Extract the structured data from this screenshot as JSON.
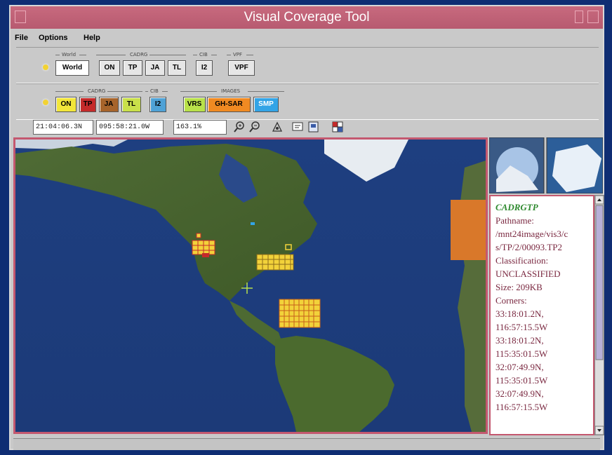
{
  "window": {
    "title": "Visual Coverage Tool"
  },
  "menu": {
    "file": "File",
    "options": "Options",
    "help": "Help"
  },
  "row1": {
    "groups": [
      "World",
      "CADRG",
      "CIB",
      "VPF"
    ],
    "buttons": [
      "World",
      "ON",
      "TP",
      "JA",
      "TL",
      "I2",
      "VPF"
    ]
  },
  "row2": {
    "groups": [
      "CADRG",
      "CIB",
      "IMAGES"
    ],
    "buttons": [
      "ON",
      "TP",
      "JA",
      "TL",
      "I2",
      "VRS",
      "GH-SAR",
      "SMP"
    ]
  },
  "coords": {
    "lat": "21:04:06.3N",
    "lon": "095:58:21.0W",
    "zoom": "163.1%"
  },
  "info": {
    "title": "CADRGTP",
    "lines": [
      "Pathname:",
      "/mnt24image/vis3/c",
      "s/TP/2/00093.TP2",
      "Classification:",
      "UNCLASSIFIED",
      "Size: 209KB",
      "Corners:",
      "  33:18:01.2N,",
      "116:57:15.5W",
      "  33:18:01.2N,",
      "115:35:01.5W",
      "  32:07:49.9N,",
      "115:35:01.5W",
      "  32:07:49.9N,",
      "116:57:15.5W"
    ]
  },
  "colors": {
    "title_bar": "#b75a70",
    "accent": "#c4586f",
    "on": "#f2e63a",
    "tp": "#c42a2a",
    "ja": "#a7642b",
    "tl": "#c9e04a",
    "i2": "#4fa2d6",
    "vrs": "#b9e14a",
    "gh_sar": "#f08a22",
    "smp": "#33a4e6",
    "coverage": "#f2d23a"
  },
  "icons": [
    "zoom-in-icon",
    "zoom-out-icon",
    "pan-icon",
    "info-icon",
    "clipboard-icon",
    "grid-icon"
  ]
}
